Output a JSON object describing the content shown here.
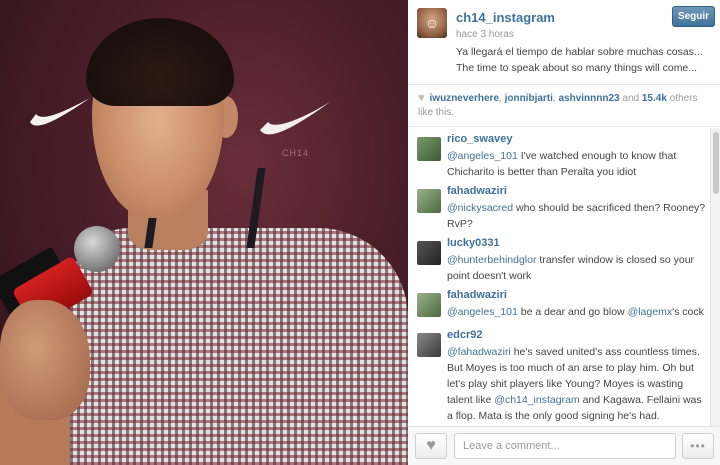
{
  "photo": {
    "shirt_text": "CH14"
  },
  "post": {
    "username": "ch14_instagram",
    "time": "hace 3 horas",
    "follow_label": "Seguir",
    "caption_lines": [
      "Ya llegará el tiempo de hablar sobre muchas cosas...",
      "The time to speak about so many things will come..."
    ]
  },
  "likes": {
    "likers": [
      "iwuzneverhere",
      "jonnibjarti",
      "ashvinnnn23"
    ],
    "and": "and",
    "count": "15.4k",
    "suffix": "others like this."
  },
  "comments": [
    {
      "user": "rico_swavey",
      "parts": [
        {
          "mention": "@angeles_101"
        },
        {
          "text": " I've watched enough to know that Chicharito is better than Peralta you idiot"
        }
      ]
    },
    {
      "user": "fahadwaziri",
      "parts": [
        {
          "mention": "@nickysacred"
        },
        {
          "text": " who should be sacrificed then? Rooney? RvP?"
        }
      ]
    },
    {
      "user": "lucky0331",
      "parts": [
        {
          "mention": "@hunterbehindglor"
        },
        {
          "text": " transfer window is closed so your point doesn't work"
        }
      ]
    },
    {
      "user": "fahadwaziri",
      "parts": [
        {
          "mention": "@angeles_101"
        },
        {
          "text": " be a dear and go blow "
        },
        {
          "mention": "@lagemx"
        },
        {
          "text": "'s cock"
        }
      ]
    },
    {
      "user": "edcr92",
      "parts": [
        {
          "mention": "@fahadwaziri"
        },
        {
          "text": " he's saved united's ass countless times. But Moyes is too much of an arse to play him. Oh but let's play shit players like Young? Moyes is wasting talent like "
        },
        {
          "mention": "@ch14_instagram"
        },
        {
          "text": " and Kagawa. Fellaini was a flop. Mata is the only good signing he's had."
        }
      ]
    }
  ],
  "footer": {
    "comment_placeholder": "Leave a comment...",
    "more_label": "•••"
  },
  "icons": {
    "heart": "heart-icon",
    "more": "more-icon"
  },
  "colors": {
    "link": "#3f729b",
    "follow_button": "#3f729b"
  }
}
